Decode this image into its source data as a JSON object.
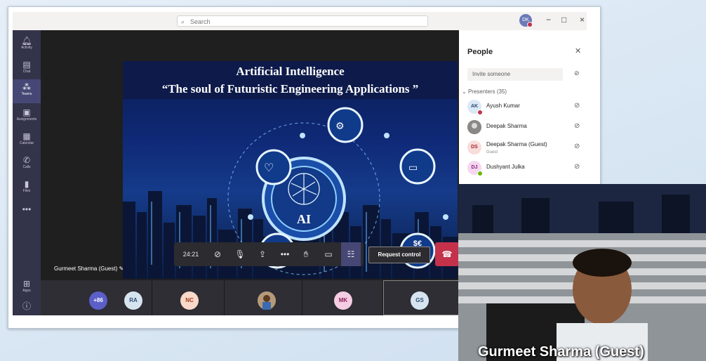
{
  "app": {
    "search_placeholder": "Search",
    "user_initials": "DK",
    "window_controls": [
      "−",
      "□",
      "×"
    ]
  },
  "rail": {
    "items": [
      {
        "label": "Activity",
        "icon": "bell-icon"
      },
      {
        "label": "Chat",
        "icon": "chat-icon"
      },
      {
        "label": "Teams",
        "icon": "teams-icon",
        "active": true
      },
      {
        "label": "Assignments",
        "icon": "assignments-icon"
      },
      {
        "label": "Calendar",
        "icon": "calendar-icon"
      },
      {
        "label": "Calls",
        "icon": "phone-icon"
      },
      {
        "label": "Files",
        "icon": "files-icon"
      },
      {
        "label": "",
        "icon": "more-icon"
      }
    ],
    "bottom": [
      {
        "label": "Apps",
        "icon": "apps-icon"
      },
      {
        "label": "",
        "icon": "help-icon"
      }
    ]
  },
  "slide": {
    "title": "Artificial Intelligence",
    "subtitle": "“The soul of Futuristic Engineering Applications ”",
    "center_label": "AI",
    "currency_label": "$€\n£¥"
  },
  "stage": {
    "presenter_label": "Gurmeet Sharma (Guest)"
  },
  "controls": {
    "timer": "24:21",
    "request_control": "Request control"
  },
  "participants_strip": [
    {
      "initials": "+86",
      "color": "#5b5fc7",
      "text_color": "#ffffff"
    },
    {
      "initials": "RA",
      "color": "#d6e4f0",
      "text_color": "#2b4a6f"
    },
    {
      "initials": "NC",
      "color": "#f9d9c9",
      "text_color": "#a13a1c"
    },
    {
      "initials": "",
      "color": "#7a6a5a",
      "text_color": "#ffffff",
      "photo": true
    },
    {
      "initials": "MK",
      "color": "#f4cde3",
      "text_color": "#8b1d5a"
    },
    {
      "initials": "GS",
      "color": "#d6e4f0",
      "text_color": "#2b4a6f"
    }
  ],
  "people": {
    "title": "People",
    "invite_placeholder": "Invite someone",
    "presenters_header": "Presenters (35)",
    "presenters": [
      {
        "initials": "AK",
        "name": "Ayush Kumar",
        "sub": "",
        "bg": "#dbe8f5",
        "fg": "#2b4a6f",
        "status": "#c4314b"
      },
      {
        "initials": "",
        "name": "Deepak Sharma",
        "sub": "",
        "bg": "#8a8886",
        "fg": "#ffffff",
        "status": "#8a8886"
      },
      {
        "initials": "DS",
        "name": "Deepak Sharma (Guest)",
        "sub": "Guest",
        "bg": "#f9dcdc",
        "fg": "#a4262c",
        "status": ""
      },
      {
        "initials": "DJ",
        "name": "Dushyant Julka",
        "sub": "",
        "bg": "#f4d6f0",
        "fg": "#8b1d7a",
        "status": "#6bb700"
      }
    ]
  },
  "video": {
    "label": "Gurmeet Sharma (Guest)"
  }
}
